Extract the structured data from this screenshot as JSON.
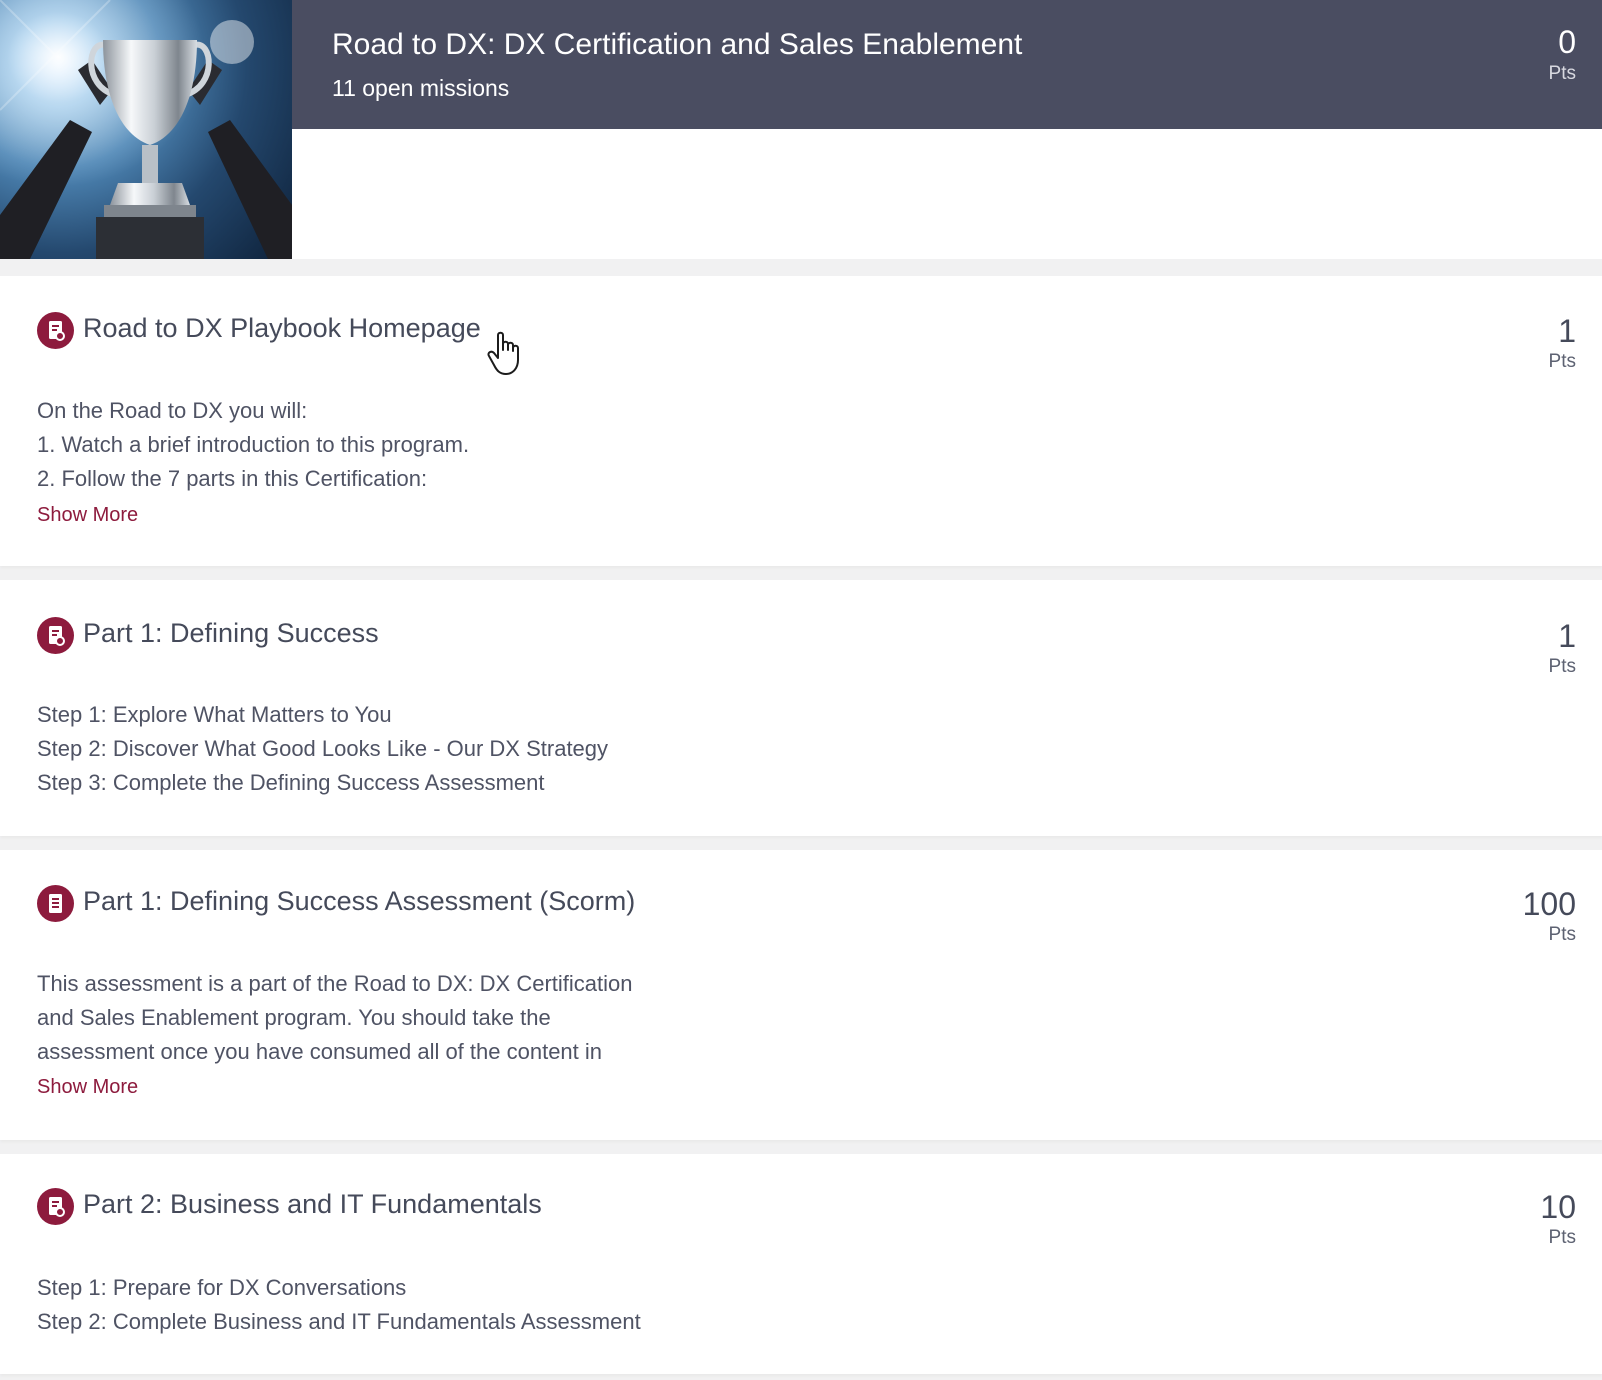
{
  "program": {
    "title": "Road to DX: DX Certification and Sales Enablement",
    "subtitle": "11 open missions",
    "points": "0",
    "points_label": "Pts",
    "hero_icon": "trophy-image"
  },
  "missions": [
    {
      "icon": "playbook-icon",
      "title": "Road to DX Playbook Homepage",
      "points": "1",
      "points_label": "Pts",
      "lines": [
        "On the Road to DX you will:",
        "1. Watch a brief introduction to this program.",
        "2. Follow the 7 parts in this Certification:"
      ],
      "show_more": "Show More"
    },
    {
      "icon": "playbook-icon",
      "title": "Part 1: Defining Success",
      "points": "1",
      "points_label": "Pts",
      "lines": [
        "Step 1: Explore What Matters to You",
        "Step 2: Discover What Good Looks Like - Our DX Strategy",
        "Step 3: Complete the Defining Success Assessment"
      ]
    },
    {
      "icon": "document-icon",
      "title": "Part 1: Defining Success Assessment (Scorm)",
      "points": "100",
      "points_label": "Pts",
      "lines": [
        "This assessment is a part of the Road to DX: DX Certification",
        "and Sales Enablement program. You should take the",
        "assessment once you have consumed all of the content in"
      ],
      "show_more": "Show More"
    },
    {
      "icon": "playbook-icon",
      "title": "Part 2: Business and IT Fundamentals",
      "points": "10",
      "points_label": "Pts",
      "lines": [
        "Step 1: Prepare for DX Conversations",
        "Step 2: Complete Business and IT Fundamentals Assessment"
      ]
    }
  ],
  "colors": {
    "banner": "#4a4d61",
    "accent": "#8d1b3d",
    "text": "#454a5a",
    "background": "#f1f1f2"
  }
}
